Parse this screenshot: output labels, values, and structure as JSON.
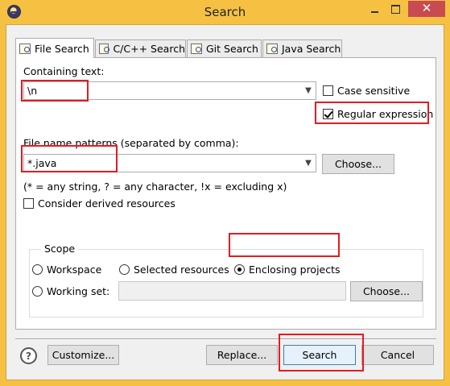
{
  "window": {
    "title": "Search",
    "close_glyph": "✕"
  },
  "tabs": [
    {
      "label": "File Search",
      "icon": "file-search-icon"
    },
    {
      "label": "C/C++ Search",
      "icon": "cpp-search-icon"
    },
    {
      "label": "Git Search",
      "icon": "git-search-icon"
    },
    {
      "label": "Java Search",
      "icon": "java-search-icon"
    }
  ],
  "containing": {
    "label": "Containing text:",
    "value": "\\n",
    "case_sensitive_label": "Case sensitive",
    "case_sensitive": false,
    "regex_label": "Regular expression",
    "regex": true
  },
  "patterns": {
    "label": "File name patterns (separated by comma):",
    "value": "*.java",
    "choose_label": "Choose...",
    "hint": "(* = any string, ? = any character, !x = excluding x)"
  },
  "derived": {
    "label": "Consider derived resources",
    "checked": false
  },
  "scope": {
    "title": "Scope",
    "workspace": "Workspace",
    "selected": "Selected resources",
    "enclosing": "Enclosing projects",
    "selected_option": "enclosing",
    "working_set": "Working set:",
    "working_set_value": "",
    "choose_label": "Choose..."
  },
  "footer": {
    "help_glyph": "?",
    "customize": "Customize...",
    "replace": "Replace...",
    "search": "Search",
    "cancel": "Cancel"
  },
  "colors": {
    "title_bar": "#f6c143",
    "close_button": "#c74b50",
    "highlight": "#e31b23"
  }
}
